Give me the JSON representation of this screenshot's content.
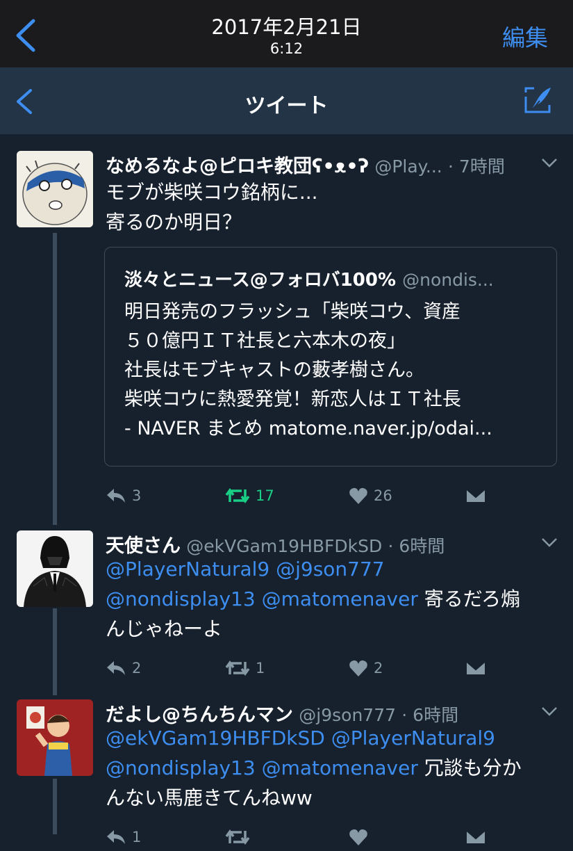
{
  "status": {
    "date": "2017年2月21日",
    "time": "6:12",
    "edit_label": "編集"
  },
  "nav": {
    "title": "ツイート"
  },
  "tweets": [
    {
      "name": "なめるなよ@ピロキ教団ʕ•ᴥ•ʔ",
      "handle": "@Play...",
      "time": "· 7時間",
      "lines": [
        "モブが柴咲コウ銘柄に...",
        "寄るのか明日？"
      ],
      "quote": {
        "name": "淡々とニュース@フォロバ100%",
        "handle": "@nondis...",
        "text": "明日発売のフラッシュ「柴咲コウ、資産\n５０億円ＩＴ社長と六本木の夜」\n社長はモブキャストの藪孝樹さん。\n柴咲コウに熱愛発覚！新恋人はＩＴ社長\n- NAVER まとめ matome.naver.jp/odai..."
      },
      "reply_count": "3",
      "retweet_count": "17",
      "like_count": "26"
    },
    {
      "name": "天使さん",
      "handle": "@ekVGam19HBFDkSD",
      "time": "· 6時間",
      "mentions1": "@PlayerNatural9 @j9son777",
      "mentions2": "@nondisplay13 @matomenaver",
      "text2": " 寄るだろ煽",
      "text3": "んじゃねーよ",
      "reply_count": "2",
      "retweet_count": "1",
      "like_count": "2"
    },
    {
      "name": "だよし@ちんちんマン",
      "handle": "@j9son777",
      "time": "· 6時間",
      "mentions1": "@ekVGam19HBFDkSD @PlayerNatural9",
      "mentions2": "@nondisplay13 @matomenaver",
      "text2": " 冗談も分か",
      "text3": "んない馬鹿きてんねww",
      "reply_count": "1"
    }
  ],
  "colors": {
    "accent": "#3d8ef0",
    "retweet_active": "#19cf86",
    "background": "#17212d",
    "navbar": "#243447",
    "muted": "#8899a6"
  }
}
